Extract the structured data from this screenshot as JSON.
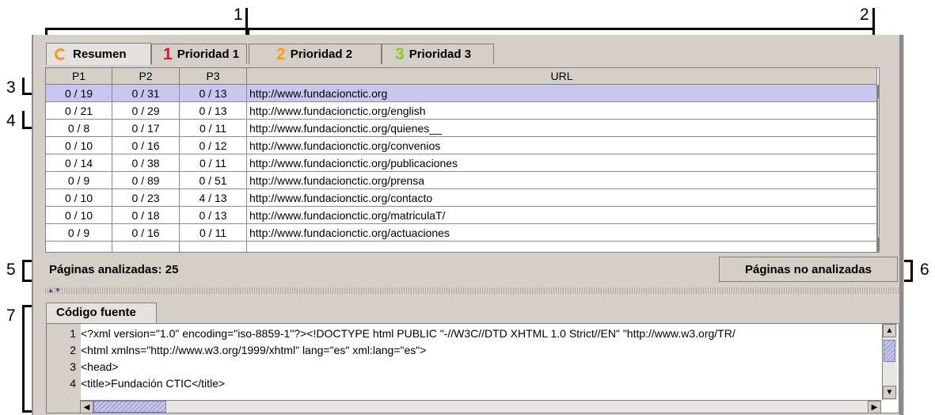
{
  "callouts": [
    "1",
    "2",
    "3",
    "4",
    "5",
    "6",
    "7"
  ],
  "tabs": [
    {
      "icon": "refresh-icon",
      "label": "Resumen"
    },
    {
      "number": "1",
      "label": "Prioridad 1",
      "color": "#e8102a"
    },
    {
      "number": "2",
      "label": "Prioridad 2",
      "color": "#f4a11c"
    },
    {
      "number": "3",
      "label": "Prioridad 3",
      "color": "#8ccc2a"
    }
  ],
  "table": {
    "columns": [
      "P1",
      "P2",
      "P3",
      "URL"
    ],
    "rows": [
      {
        "p1": "0 / 19",
        "p2": "0 / 31",
        "p3": "0 / 13",
        "url": "http://www.fundacionctic.org",
        "selected": true
      },
      {
        "p1": "0 / 21",
        "p2": "0 / 29",
        "p3": "0 / 13",
        "url": "http://www.fundacionctic.org/english"
      },
      {
        "p1": "0 / 8",
        "p2": "0 / 17",
        "p3": "0 / 11",
        "url": "http://www.fundacionctic.org/quienes__"
      },
      {
        "p1": "0 / 10",
        "p2": "0 / 16",
        "p3": "0 / 12",
        "url": "http://www.fundacionctic.org/convenios"
      },
      {
        "p1": "0 / 14",
        "p2": "0 / 38",
        "p3": "0 / 11",
        "url": "http://www.fundacionctic.org/publicaciones"
      },
      {
        "p1": "0 / 9",
        "p2": "0 / 89",
        "p3": "0 / 51",
        "url": "http://www.fundacionctic.org/prensa"
      },
      {
        "p1": "0 / 10",
        "p2": "0 / 23",
        "p3": "4 / 13",
        "url": "http://www.fundacionctic.org/contacto"
      },
      {
        "p1": "0 / 10",
        "p2": "0 / 18",
        "p3": "0 / 13",
        "url": "http://www.fundacionctic.org/matriculaT/"
      },
      {
        "p1": "0 / 9",
        "p2": "0 / 16",
        "p3": "0 / 11",
        "url": "http://www.fundacionctic.org/actuaciones"
      }
    ]
  },
  "status": {
    "label": "Páginas analizadas: 25"
  },
  "buttons": {
    "not_analyzed": "Páginas no analizadas"
  },
  "code_pane": {
    "tab_label": "Código fuente",
    "lines": [
      {
        "n": "1",
        "text": "<?xml version=\"1.0\" encoding=\"iso-8859-1\"?><!DOCTYPE html PUBLIC \"-//W3C//DTD XHTML 1.0 Strict//EN\"  \"http://www.w3.org/TR/"
      },
      {
        "n": "2",
        "text": "<html xmlns=\"http://www.w3.org/1999/xhtml\" lang=\"es\" xml:lang=\"es\">"
      },
      {
        "n": "3",
        "text": "<head>"
      },
      {
        "n": "4",
        "text": "<title>Fundación CTIC</title>"
      }
    ]
  }
}
